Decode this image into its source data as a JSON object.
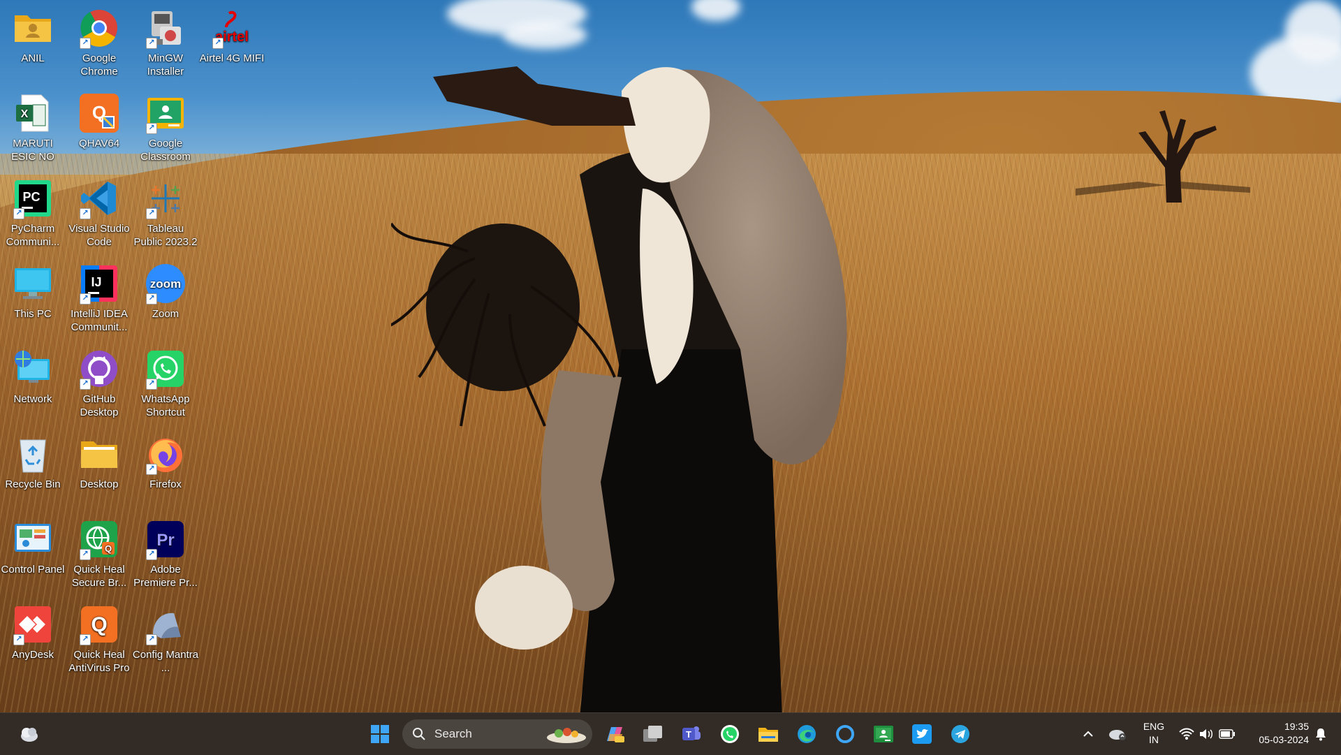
{
  "desktop": {
    "icons": [
      {
        "label": "ANIL",
        "icon": "user-folder-icon"
      },
      {
        "label": "Google Chrome",
        "icon": "chrome-icon"
      },
      {
        "label": "MinGW Installer",
        "icon": "mingw-installer-icon"
      },
      {
        "label": "Airtel 4G MIFI",
        "icon": "airtel-icon",
        "logo_text": "airtel"
      },
      {
        "label": "MARUTI ESIC NO",
        "icon": "excel-file-icon",
        "logo_text": "X"
      },
      {
        "label": "QHAV64",
        "icon": "quick-heal-installer-icon",
        "logo_text": "Q"
      },
      {
        "label": "Google Classroom",
        "icon": "google-classroom-icon"
      },
      {
        "label": "PyCharm Communi...",
        "icon": "pycharm-icon",
        "logo_text": "PC"
      },
      {
        "label": "Visual Studio Code",
        "icon": "vscode-icon"
      },
      {
        "label": "Tableau Public 2023.2",
        "icon": "tableau-icon"
      },
      {
        "label": "This PC",
        "icon": "monitor-icon"
      },
      {
        "label": "IntelliJ IDEA Communit...",
        "icon": "intellij-icon",
        "logo_text": "IJ"
      },
      {
        "label": "Zoom",
        "icon": "zoom-icon",
        "logo_text": "zoom"
      },
      {
        "label": "Network",
        "icon": "network-icon"
      },
      {
        "label": "GitHub Desktop",
        "icon": "github-icon"
      },
      {
        "label": "WhatsApp Shortcut",
        "icon": "whatsapp-icon"
      },
      {
        "label": "Recycle Bin",
        "icon": "recycle-bin-icon"
      },
      {
        "label": "Desktop",
        "icon": "folder-icon"
      },
      {
        "label": "Firefox",
        "icon": "firefox-icon"
      },
      {
        "label": "Control Panel",
        "icon": "control-panel-icon"
      },
      {
        "label": "Quick Heal Secure Br...",
        "icon": "quick-heal-browser-icon",
        "logo_text": "Q"
      },
      {
        "label": "Adobe Premiere Pr...",
        "icon": "premiere-pro-icon",
        "logo_text": "Pr"
      },
      {
        "label": "AnyDesk",
        "icon": "anydesk-icon"
      },
      {
        "label": "Quick Heal AntiVirus Pro",
        "icon": "quick-heal-antivirus-icon",
        "logo_text": "Q"
      },
      {
        "label": "Config Mantra ...",
        "icon": "config-mantra-icon"
      }
    ]
  },
  "taskbar": {
    "search_label": "Search",
    "pinned": [
      "windows-start-icon",
      "search-icon",
      "copilot-icon",
      "task-view-icon",
      "teams-icon",
      "whatsapp-icon",
      "file-explorer-icon",
      "edge-icon",
      "cortana-icon",
      "google-classroom-icon",
      "twitter-icon",
      "telegram-icon"
    ],
    "weather_icon": "weather-icon",
    "tray": {
      "lang_line1": "ENG",
      "lang_line2": "IN",
      "time": "19:35",
      "date": "05-03-2024"
    }
  },
  "colors": {
    "taskbar_bg": "#241c16",
    "sky": "#4b91cc",
    "field": "#b9853e"
  }
}
